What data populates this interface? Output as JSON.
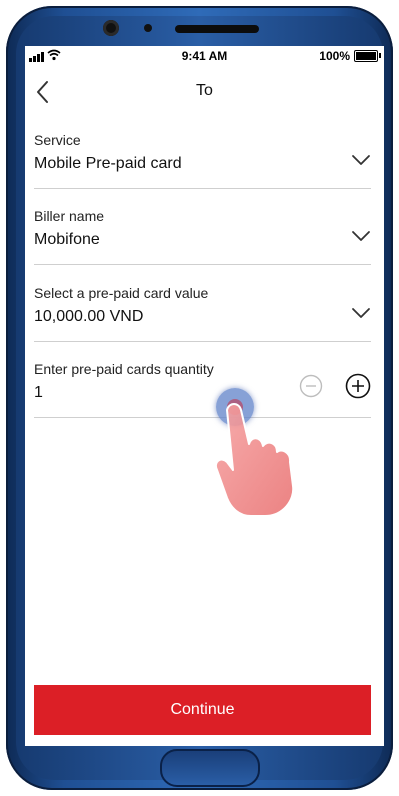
{
  "status_bar": {
    "time": "9:41 AM",
    "battery_percent": "100%",
    "battery_level": 1.0
  },
  "nav": {
    "back_icon": "chevron-left-icon",
    "title": "To"
  },
  "form": {
    "service": {
      "label": "Service",
      "value": "Mobile Pre-paid card"
    },
    "biller": {
      "label": "Biller name",
      "value": "Mobifone"
    },
    "card_value": {
      "label": "Select a pre-paid card value",
      "value": "10,000.00 VND"
    },
    "quantity": {
      "label": "Enter pre-paid cards quantity",
      "value": "1"
    }
  },
  "actions": {
    "continue_label": "Continue"
  },
  "colors": {
    "accent_red": "#dc1f26",
    "phone_frame": "#2a5ea6",
    "touch_indicator": "#5f82c8",
    "hand": "#f08a8a"
  },
  "icons": {
    "dropdown": "chevron-down-icon",
    "decrement": "minus-circle-icon",
    "increment": "plus-circle-icon",
    "touch": "touch-indicator-icon",
    "hand": "pointing-hand-icon"
  }
}
